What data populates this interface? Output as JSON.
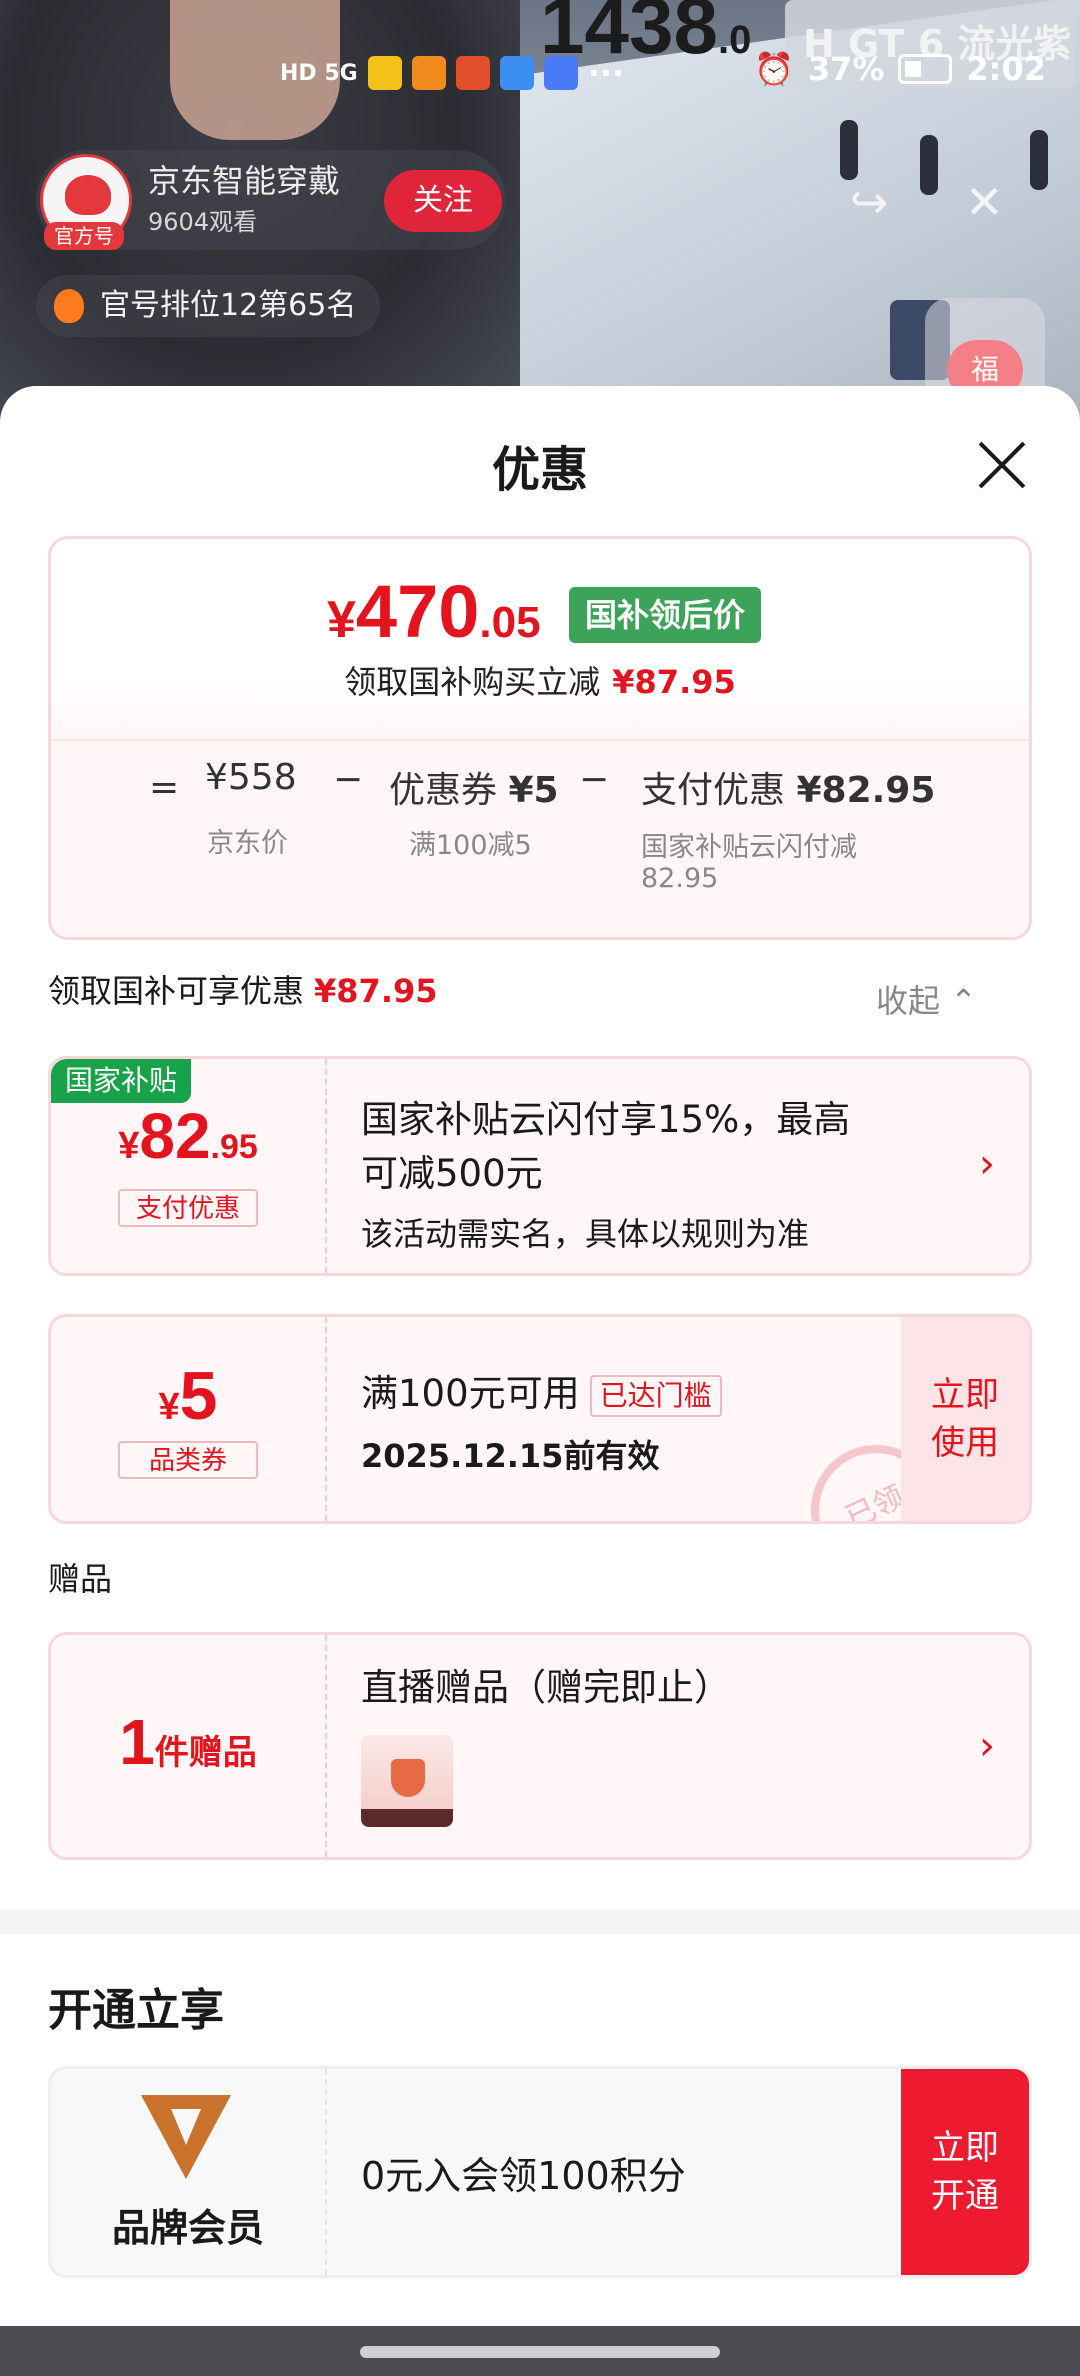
{
  "live": {
    "price_int": "1438",
    "price_dec": ".0",
    "model_tag": "H GT 6 流光紫",
    "streamer_name": "京东智能穿戴",
    "official_label": "官方号",
    "viewers": "9604观看",
    "follow_label": "关注",
    "rank_text": "官号排位12第65名",
    "fu_label": "福"
  },
  "status_bar": {
    "network": "HD 5G",
    "battery": "37%",
    "time": "2:02",
    "more": "···"
  },
  "sheet": {
    "title": "优惠",
    "summary": {
      "price_symbol": "¥",
      "price_int": "470",
      "price_dec": ".05",
      "tag": "国补领后价",
      "instant_text": "领取国补购买立减",
      "instant_amount": "¥87.95",
      "eq": "=",
      "minus1": "−",
      "minus2": "−",
      "jd_price": "¥558",
      "jd_price_label": "京东价",
      "coupon_label": "优惠券",
      "coupon_value": "¥5",
      "coupon_rule": "满100减5",
      "pay_label": "支付优惠",
      "pay_value": "¥82.95",
      "pay_rule_line1": "国家补贴云闪付减",
      "pay_rule_line2": "82.95"
    },
    "benefits_label": "领取国补可享优惠",
    "benefits_amount": "¥87.95",
    "collapse_label": "收起 ⌃",
    "subsidy": {
      "corner_tag": "国家补贴",
      "symbol": "¥",
      "int": "82",
      "dec": ".95",
      "tag": "支付优惠",
      "line1": "国家补贴云闪付享15%，最高",
      "line2": "可减500元",
      "line3": "该活动需实名，具体以规则为准",
      "chevron": "›"
    },
    "coupon": {
      "symbol": "¥",
      "value": "5",
      "tag": "品类券",
      "condition": "满100元可用",
      "reached": "已达门槛",
      "valid": "2025.12.15前有效",
      "use_line1": "立即",
      "use_line2": "使用",
      "stamp": "已领"
    },
    "gift_section": "赠品",
    "gift": {
      "count": "1",
      "unit": "件赠品",
      "title": "直播赠品（赠完即止）",
      "chevron": "›"
    },
    "member_section": "开通立享",
    "member": {
      "name": "品牌会员",
      "offer": "0元入会领100积分",
      "btn_line1": "立即",
      "btn_line2": "开通"
    }
  },
  "colors": {
    "accent_red": "#e4141f",
    "subsidy_green": "#3da35a",
    "brand_gold": "#c9722b"
  }
}
